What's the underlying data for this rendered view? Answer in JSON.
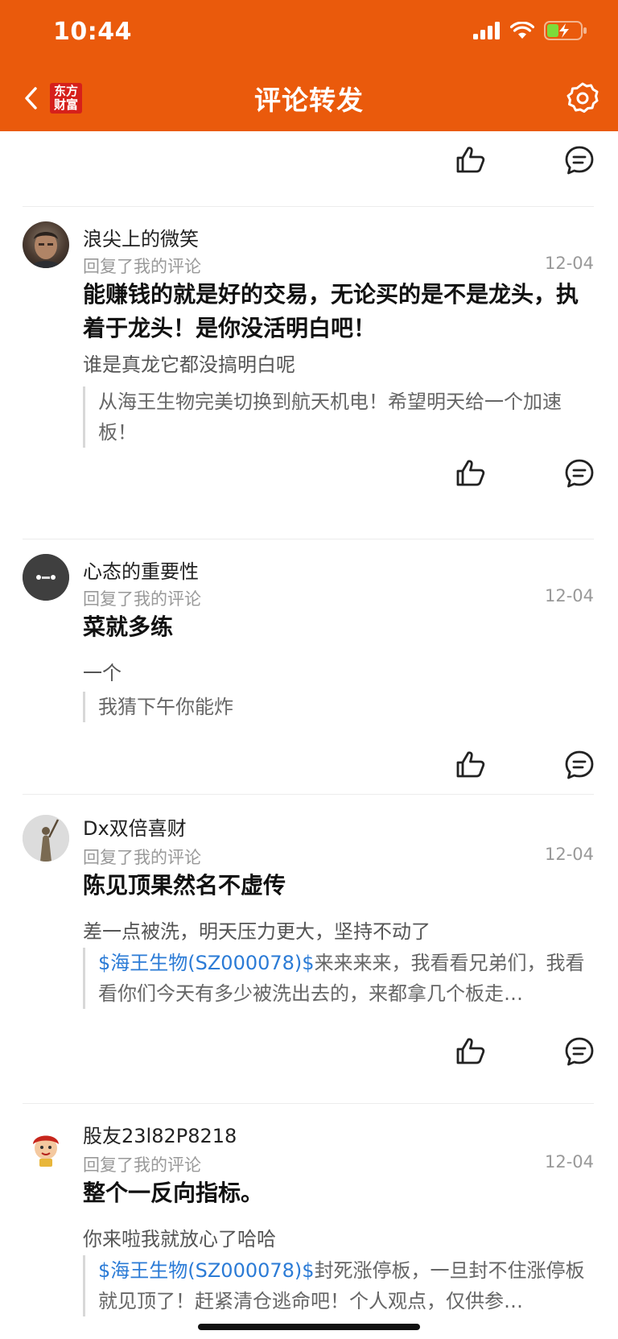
{
  "status_bar": {
    "time": "10:44"
  },
  "nav": {
    "title": "评论转发",
    "logo_line1": "东方",
    "logo_line2": "财富"
  },
  "comments": [
    {
      "username": "浪尖上的微笑",
      "subtitle": "回复了我的评论",
      "date": "12-04",
      "reply": "能赚钱的就是好的交易，无论买的是不是龙头，执着于龙头！是你没活明白吧！",
      "my_comment": "谁是真龙它都没搞明白呢",
      "quote_stock": "",
      "quote_text": "从海王生物完美切换到航天机电！希望明天给一个加速板！"
    },
    {
      "username": "心态的重要性",
      "subtitle": "回复了我的评论",
      "date": "12-04",
      "reply": "菜就多练",
      "my_comment": "一个",
      "quote_stock": "",
      "quote_text": "我猜下午你能炸"
    },
    {
      "username": "Dx双倍喜财",
      "subtitle": "回复了我的评论",
      "date": "12-04",
      "reply": "陈见顶果然名不虚传",
      "my_comment": "差一点被洗，明天压力更大，坚持不动了",
      "quote_stock": "$海王生物(SZ000078)$",
      "quote_text": "来来来来，我看看兄弟们，我看看你们今天有多少被洗出去的，来都拿几个板走…"
    },
    {
      "username": "股友23l82P8218",
      "subtitle": "回复了我的评论",
      "date": "12-04",
      "reply": "整个一反向指标。",
      "my_comment": "你来啦我就放心了哈哈",
      "quote_stock": "$海王生物(SZ000078)$",
      "quote_text": "封死涨停板，一旦封不住涨停板就见顶了！赶紧清仓逃命吧！个人观点，仅供参…"
    }
  ],
  "colors": {
    "brand": "#ea5a0c",
    "stock_link": "#2b7bd6"
  },
  "icons": [
    "back-icon",
    "settings-icon",
    "like-icon",
    "comment-icon"
  ]
}
